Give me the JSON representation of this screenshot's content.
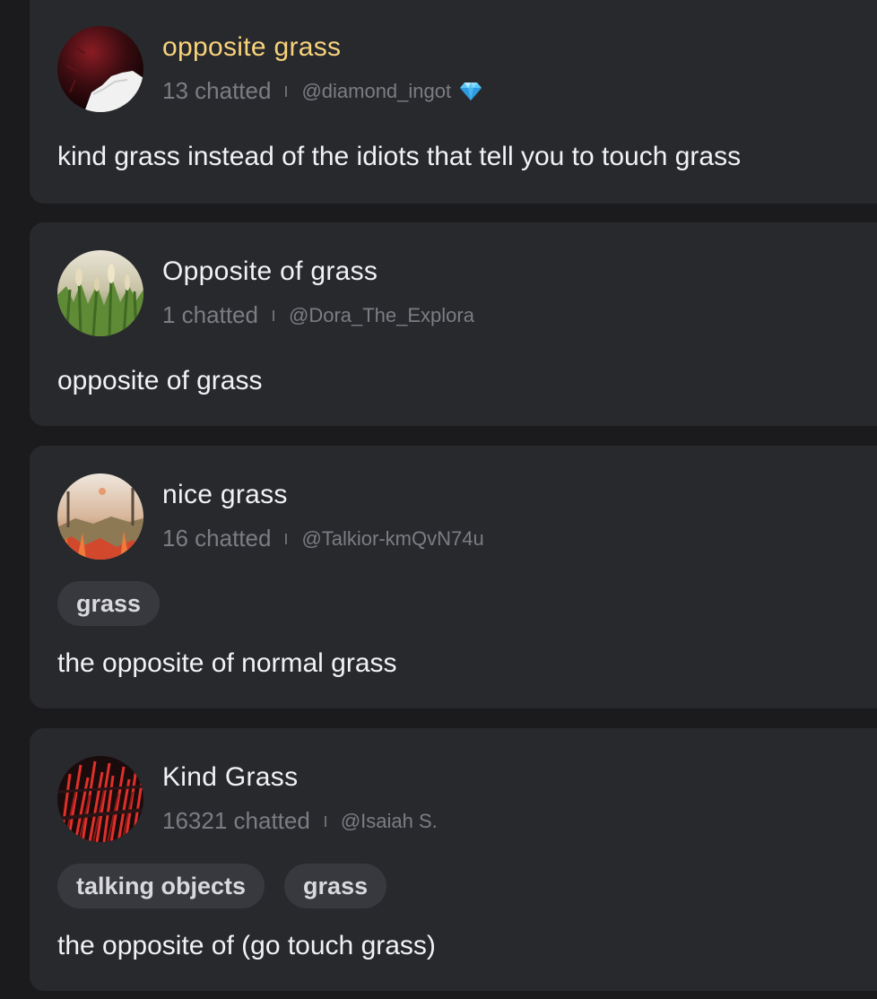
{
  "cards": [
    {
      "name": "opposite grass",
      "chatted": "13 chatted",
      "handle": "@diamond_ingot",
      "badge_icon": "diamond-icon",
      "description": "kind grass instead of the idiots that tell you to touch grass",
      "tags": []
    },
    {
      "name": "Opposite of grass",
      "chatted": "1 chatted",
      "handle": "@Dora_The_Explora",
      "description": "opposite of grass",
      "tags": []
    },
    {
      "name": "nice grass",
      "chatted": "16 chatted",
      "handle": "@Talkior-kmQvN74u",
      "description": "the opposite of normal grass",
      "tags": [
        "grass"
      ]
    },
    {
      "name": "Kind Grass",
      "chatted": "16321 chatted",
      "handle": "@Isaiah S.",
      "description": "the opposite of (go touch grass)",
      "tags": [
        "talking objects",
        "grass"
      ]
    }
  ],
  "colors": {
    "page_background": "#1b1b1d",
    "card_background": "#28292d",
    "highlight_name": "#f7d27b",
    "muted_text": "#7c7d83",
    "tag_background": "#38393e"
  }
}
